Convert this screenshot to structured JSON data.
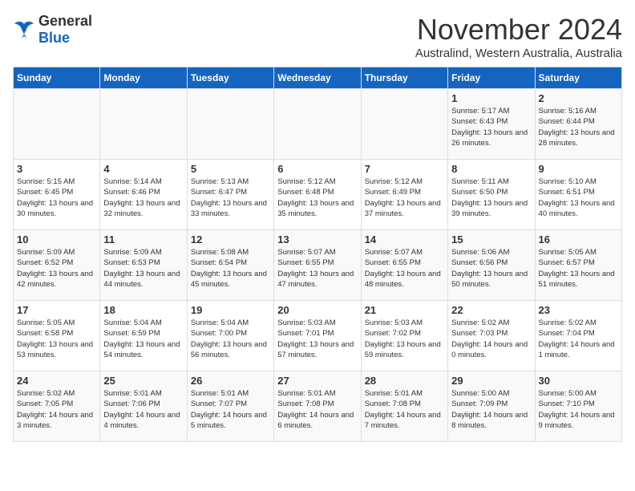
{
  "logo": {
    "general": "General",
    "blue": "Blue"
  },
  "title": "November 2024",
  "location": "Australind, Western Australia, Australia",
  "days_of_week": [
    "Sunday",
    "Monday",
    "Tuesday",
    "Wednesday",
    "Thursday",
    "Friday",
    "Saturday"
  ],
  "weeks": [
    [
      {
        "day": "",
        "info": ""
      },
      {
        "day": "",
        "info": ""
      },
      {
        "day": "",
        "info": ""
      },
      {
        "day": "",
        "info": ""
      },
      {
        "day": "",
        "info": ""
      },
      {
        "day": "1",
        "info": "Sunrise: 5:17 AM\nSunset: 6:43 PM\nDaylight: 13 hours and 26 minutes."
      },
      {
        "day": "2",
        "info": "Sunrise: 5:16 AM\nSunset: 6:44 PM\nDaylight: 13 hours and 28 minutes."
      }
    ],
    [
      {
        "day": "3",
        "info": "Sunrise: 5:15 AM\nSunset: 6:45 PM\nDaylight: 13 hours and 30 minutes."
      },
      {
        "day": "4",
        "info": "Sunrise: 5:14 AM\nSunset: 6:46 PM\nDaylight: 13 hours and 32 minutes."
      },
      {
        "day": "5",
        "info": "Sunrise: 5:13 AM\nSunset: 6:47 PM\nDaylight: 13 hours and 33 minutes."
      },
      {
        "day": "6",
        "info": "Sunrise: 5:12 AM\nSunset: 6:48 PM\nDaylight: 13 hours and 35 minutes."
      },
      {
        "day": "7",
        "info": "Sunrise: 5:12 AM\nSunset: 6:49 PM\nDaylight: 13 hours and 37 minutes."
      },
      {
        "day": "8",
        "info": "Sunrise: 5:11 AM\nSunset: 6:50 PM\nDaylight: 13 hours and 39 minutes."
      },
      {
        "day": "9",
        "info": "Sunrise: 5:10 AM\nSunset: 6:51 PM\nDaylight: 13 hours and 40 minutes."
      }
    ],
    [
      {
        "day": "10",
        "info": "Sunrise: 5:09 AM\nSunset: 6:52 PM\nDaylight: 13 hours and 42 minutes."
      },
      {
        "day": "11",
        "info": "Sunrise: 5:09 AM\nSunset: 6:53 PM\nDaylight: 13 hours and 44 minutes."
      },
      {
        "day": "12",
        "info": "Sunrise: 5:08 AM\nSunset: 6:54 PM\nDaylight: 13 hours and 45 minutes."
      },
      {
        "day": "13",
        "info": "Sunrise: 5:07 AM\nSunset: 6:55 PM\nDaylight: 13 hours and 47 minutes."
      },
      {
        "day": "14",
        "info": "Sunrise: 5:07 AM\nSunset: 6:55 PM\nDaylight: 13 hours and 48 minutes."
      },
      {
        "day": "15",
        "info": "Sunrise: 5:06 AM\nSunset: 6:56 PM\nDaylight: 13 hours and 50 minutes."
      },
      {
        "day": "16",
        "info": "Sunrise: 5:05 AM\nSunset: 6:57 PM\nDaylight: 13 hours and 51 minutes."
      }
    ],
    [
      {
        "day": "17",
        "info": "Sunrise: 5:05 AM\nSunset: 6:58 PM\nDaylight: 13 hours and 53 minutes."
      },
      {
        "day": "18",
        "info": "Sunrise: 5:04 AM\nSunset: 6:59 PM\nDaylight: 13 hours and 54 minutes."
      },
      {
        "day": "19",
        "info": "Sunrise: 5:04 AM\nSunset: 7:00 PM\nDaylight: 13 hours and 56 minutes."
      },
      {
        "day": "20",
        "info": "Sunrise: 5:03 AM\nSunset: 7:01 PM\nDaylight: 13 hours and 57 minutes."
      },
      {
        "day": "21",
        "info": "Sunrise: 5:03 AM\nSunset: 7:02 PM\nDaylight: 13 hours and 59 minutes."
      },
      {
        "day": "22",
        "info": "Sunrise: 5:02 AM\nSunset: 7:03 PM\nDaylight: 14 hours and 0 minutes."
      },
      {
        "day": "23",
        "info": "Sunrise: 5:02 AM\nSunset: 7:04 PM\nDaylight: 14 hours and 1 minute."
      }
    ],
    [
      {
        "day": "24",
        "info": "Sunrise: 5:02 AM\nSunset: 7:05 PM\nDaylight: 14 hours and 3 minutes."
      },
      {
        "day": "25",
        "info": "Sunrise: 5:01 AM\nSunset: 7:06 PM\nDaylight: 14 hours and 4 minutes."
      },
      {
        "day": "26",
        "info": "Sunrise: 5:01 AM\nSunset: 7:07 PM\nDaylight: 14 hours and 5 minutes."
      },
      {
        "day": "27",
        "info": "Sunrise: 5:01 AM\nSunset: 7:08 PM\nDaylight: 14 hours and 6 minutes."
      },
      {
        "day": "28",
        "info": "Sunrise: 5:01 AM\nSunset: 7:08 PM\nDaylight: 14 hours and 7 minutes."
      },
      {
        "day": "29",
        "info": "Sunrise: 5:00 AM\nSunset: 7:09 PM\nDaylight: 14 hours and 8 minutes."
      },
      {
        "day": "30",
        "info": "Sunrise: 5:00 AM\nSunset: 7:10 PM\nDaylight: 14 hours and 9 minutes."
      }
    ]
  ]
}
